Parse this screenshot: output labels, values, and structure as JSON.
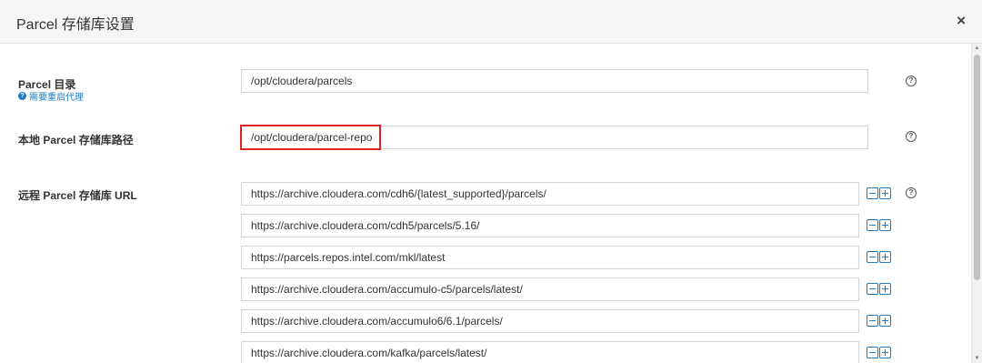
{
  "dialog": {
    "title": "Parcel 存储库设置",
    "close_glyph": "×"
  },
  "parcel_dir": {
    "label": "Parcel 目录",
    "restart_note": "需要重启代理",
    "value": "/opt/cloudera/parcels"
  },
  "local_repo": {
    "label": "本地 Parcel 存储库路径",
    "value": "/opt/cloudera/parcel-repo"
  },
  "remote_repo": {
    "label": "远程 Parcel 存储库 URL",
    "urls": [
      "https://archive.cloudera.com/cdh6/{latest_supported}/parcels/",
      "https://archive.cloudera.com/cdh5/parcels/5.16/",
      "https://parcels.repos.intel.com/mkl/latest",
      "https://archive.cloudera.com/accumulo-c5/parcels/latest/",
      "https://archive.cloudera.com/accumulo6/6.1/parcels/",
      "https://archive.cloudera.com/kafka/parcels/latest/"
    ]
  },
  "icons": {
    "help": "?",
    "restart_note_icon": "?"
  },
  "colors": {
    "accent": "#1f7bc1",
    "highlight": "#e02424",
    "header_bg": "#f5f6f7"
  }
}
